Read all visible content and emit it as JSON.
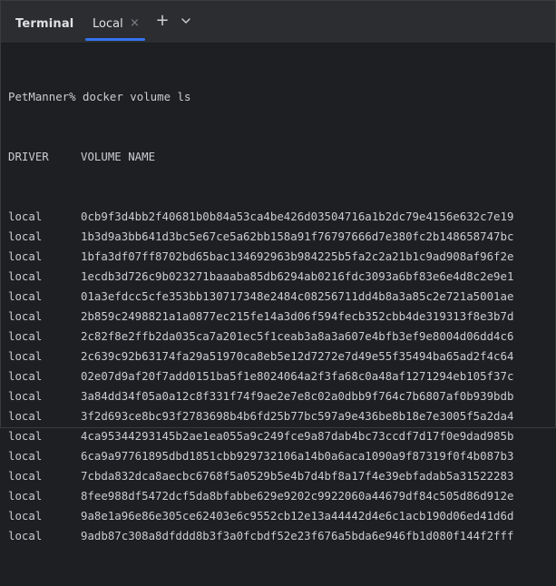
{
  "header": {
    "title": "Terminal",
    "tab_label": "Local",
    "close_glyph": "×",
    "new_tab_glyph": "+",
    "dropdown_icon": "chevron-down-icon"
  },
  "terminal": {
    "prompt": "PetManner% docker volume ls",
    "headers": {
      "driver": "DRIVER",
      "volume": "VOLUME NAME"
    },
    "rows": [
      {
        "driver": "local",
        "name": "0cb9f3d4bb2f40681b0b84a53ca4be426d03504716a1b2dc79e4156e632c7e19"
      },
      {
        "driver": "local",
        "name": "1b3d9a3bb641d3bc5e67ce5a62bb158a91f76797666d7e380fc2b148658747bc"
      },
      {
        "driver": "local",
        "name": "1bfa3df07ff8702bd65bac134692963b984225b5fa2c2a21b1c9ad908af96f2e"
      },
      {
        "driver": "local",
        "name": "1ecdb3d726c9b023271baaaba85db6294ab0216fdc3093a6bf83e6e4d8c2e9e1"
      },
      {
        "driver": "local",
        "name": "01a3efdcc5cfe353bb130717348e2484c08256711dd4b8a3a85c2e721a5001ae"
      },
      {
        "driver": "local",
        "name": "2b859c2498821a1a0877ec215fe14a3d06f594fecb352cbb4de319313f8e3b7d"
      },
      {
        "driver": "local",
        "name": "2c82f8e2ffb2da035ca7a201ec5f1ceab3a8a3a607e4bfb3ef9e8004d06dd4c6"
      },
      {
        "driver": "local",
        "name": "2c639c92b63174fa29a51970ca8eb5e12d7272e7d49e55f35494ba65ad2f4c64"
      },
      {
        "driver": "local",
        "name": "02e07d9af20f7add0151ba5f1e8024064a2f3fa68c0a48af1271294eb105f37c"
      },
      {
        "driver": "local",
        "name": "3a84dd34f05a0a12c8f331f74f9ae2e7e8c02a0dbb9f764c7b6807af0b939bdb"
      },
      {
        "driver": "local",
        "name": "3f2d693ce8bc93f2783698b4b6fd25b77bc597a9e436be8b18e7e3005f5a2da4"
      },
      {
        "driver": "local",
        "name": "4ca95344293145b2ae1ea055a9c249fce9a87dab4bc73ccdf7d17f0e9dad985b"
      },
      {
        "driver": "local",
        "name": "6ca9a97761895dbd1851cbb929732106a14b0a6aca1090a9f87319f0f4b087b3"
      },
      {
        "driver": "local",
        "name": "7cbda832dca8aecbc6768f5a0529b5e4b7d4bf8a17f4e39ebfadab5a31522283"
      },
      {
        "driver": "local",
        "name": "8fee988df5472dcf5da8bfabbe629e9202c9922060a44679df84c505d86d912e"
      },
      {
        "driver": "local",
        "name": "9a8e1a96e86e305ce62403e6c9552cb12e13a44442d4e6c1acb190d06ed41d6d"
      },
      {
        "driver": "local",
        "name": "9adb87c308a8dfddd8b3f3a0fcbdf52e23f676a5bda6e946fb1d080f144f2fff"
      }
    ]
  },
  "colors": {
    "background": "#1e1f22",
    "toolbar": "#2b2d30",
    "text": "#c9ccd1",
    "accent": "#3574f0"
  }
}
